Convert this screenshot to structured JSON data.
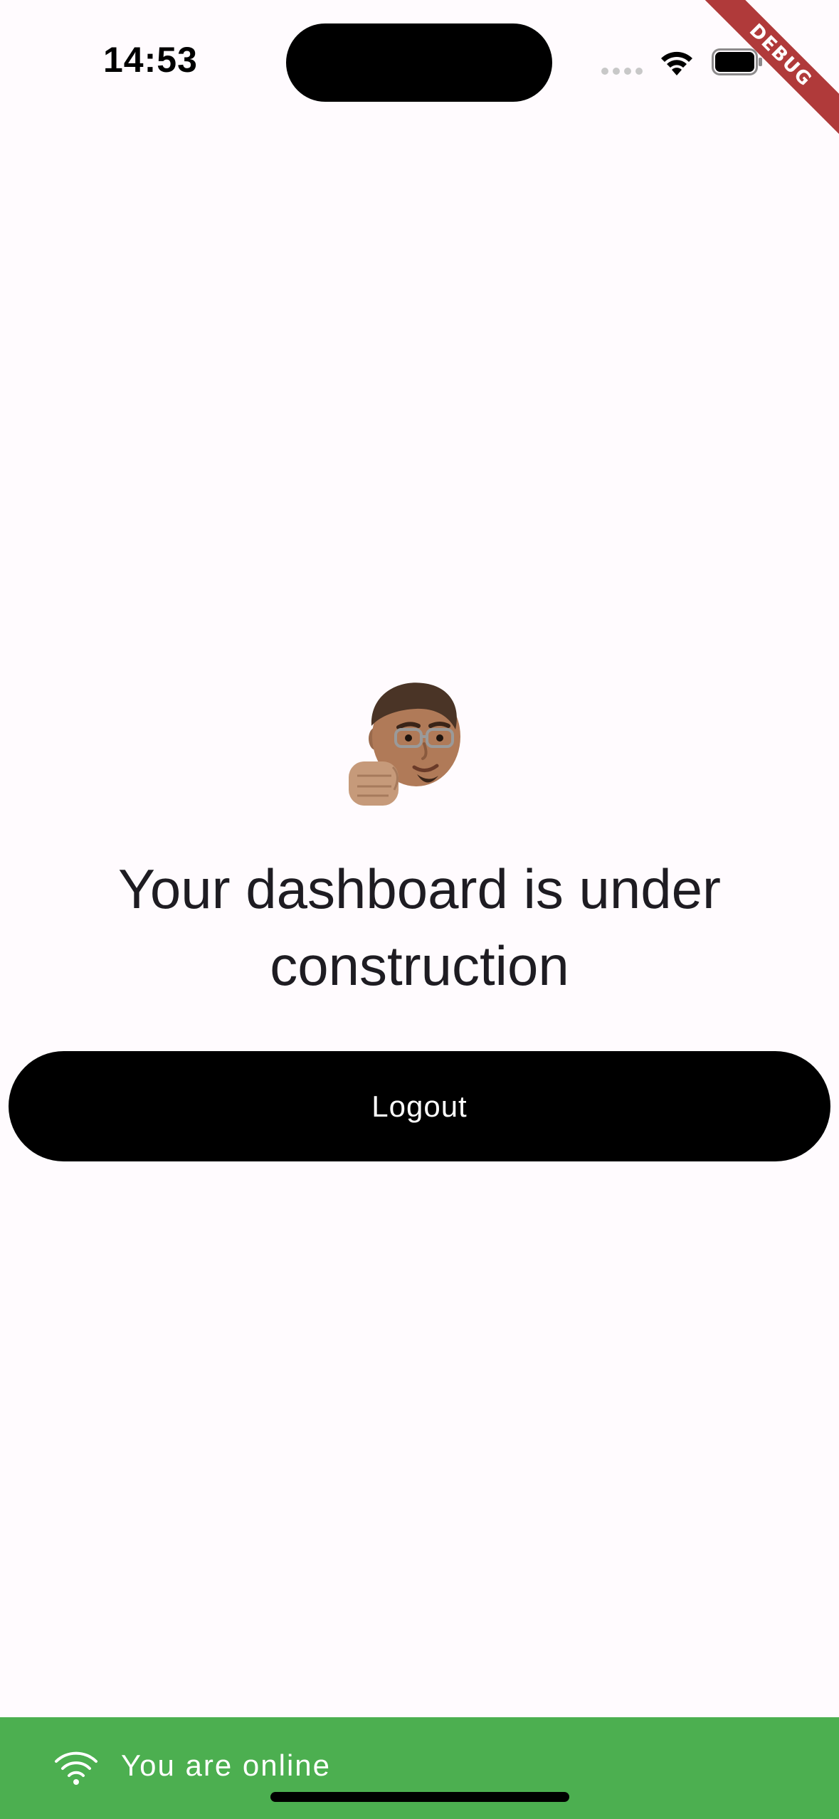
{
  "status_bar": {
    "time": "14:53",
    "icons": [
      "cellular-signal-icon",
      "wifi-icon",
      "battery-icon"
    ]
  },
  "debug_banner": {
    "label": "DEBUG",
    "color": "#b03a3a"
  },
  "main": {
    "illustration": "memoji-avatar",
    "headline": "Your dashboard is under construction",
    "logout_label": "Logout"
  },
  "connectivity_banner": {
    "icon": "wifi-icon",
    "text": "You are online",
    "color": "#4caf50"
  },
  "colors": {
    "background": "#fffbfe",
    "button": "#000000",
    "button_text": "#ffffff",
    "headline_text": "#1e1c22"
  }
}
